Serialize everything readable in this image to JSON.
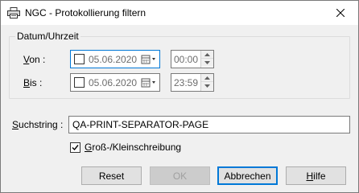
{
  "window": {
    "title": "NGC - Protokollierung filtern",
    "icon": "printer-icon",
    "close_icon": "close-icon"
  },
  "datetime_group": {
    "label": "Datum/Uhrzeit",
    "from": {
      "label_underlined": "V",
      "label_rest": "on :",
      "date_checked": false,
      "date_value": "05.06.2020",
      "time_value": "00:00"
    },
    "to": {
      "label_underlined": "B",
      "label_rest": "is :",
      "date_checked": false,
      "date_value": "05.06.2020",
      "time_value": "23:59"
    }
  },
  "search": {
    "label_underlined": "S",
    "label_rest": "uchstring :",
    "value": "QA-PRINT-SEPARATOR-PAGE"
  },
  "case_sensitive": {
    "checked": true,
    "label_underlined": "G",
    "label_rest": "roß-/Kleinschreibung"
  },
  "buttons": {
    "reset": "Reset",
    "ok": "OK",
    "cancel": "Abbrechen",
    "help_underlined": "H",
    "help_rest": "ilfe"
  },
  "colors": {
    "focus_border": "#0078d7",
    "window_bg": "#f0f0f0"
  }
}
